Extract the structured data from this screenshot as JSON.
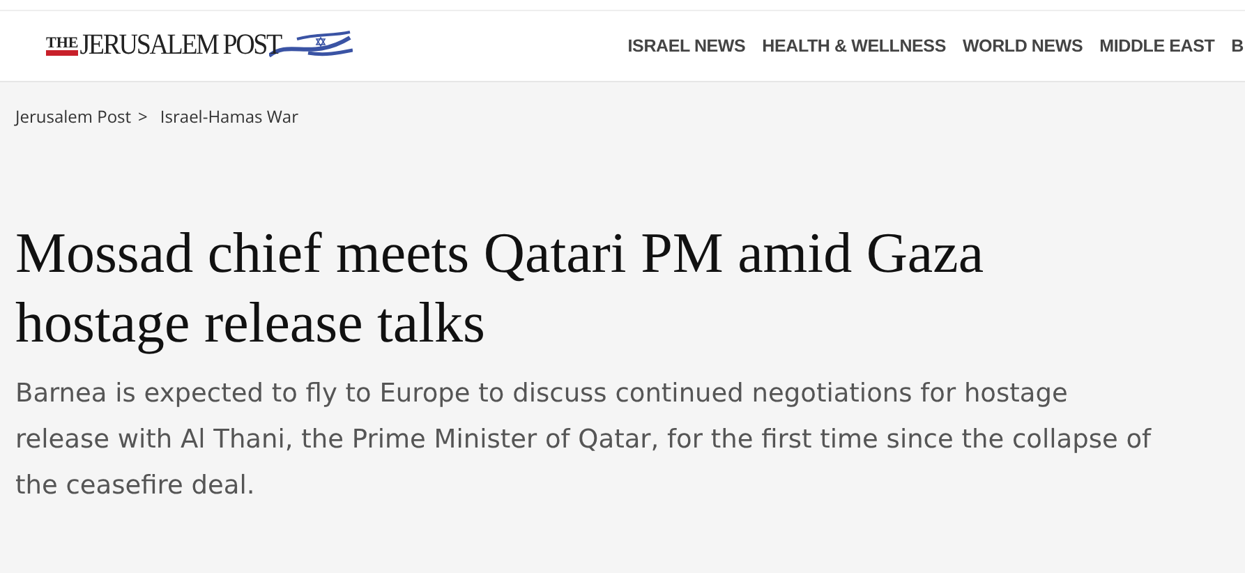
{
  "header": {
    "logo": {
      "prefix": "THE",
      "name": "JERUSALEM POST"
    },
    "nav": [
      "ISRAEL NEWS",
      "HEALTH & WELLNESS",
      "WORLD NEWS",
      "MIDDLE EAST",
      "B"
    ]
  },
  "breadcrumb": [
    {
      "label": "Jerusalem Post",
      "separator": ">"
    },
    {
      "label": "Israel-Hamas War"
    }
  ],
  "article": {
    "title": "Mossad chief meets Qatari PM amid Gaza hostage release talks",
    "subtitle": "Barnea is expected to fly to Europe to discuss continued negotiations for hostage release with Al Thani, the Prime Minister of Qatar, for the first time since the collapse of the ceasefire deal."
  }
}
